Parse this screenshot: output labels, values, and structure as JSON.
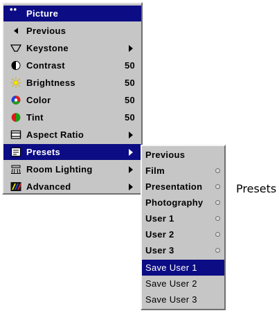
{
  "main_menu": {
    "title": "Picture",
    "items": [
      {
        "label": "Previous",
        "icon": "left-arrow-icon"
      },
      {
        "label": "Keystone",
        "icon": "keystone-icon",
        "submenu": true
      },
      {
        "label": "Contrast",
        "icon": "contrast-icon",
        "value": "50"
      },
      {
        "label": "Brightness",
        "icon": "brightness-icon",
        "value": "50"
      },
      {
        "label": "Color",
        "icon": "color-icon",
        "value": "50"
      },
      {
        "label": "Tint",
        "icon": "tint-icon",
        "value": "50"
      },
      {
        "label": "Aspect Ratio",
        "icon": "aspect-ratio-icon",
        "submenu": true
      },
      {
        "label": "Presets",
        "icon": "presets-icon",
        "submenu": true,
        "selected": true
      },
      {
        "label": "Room Lighting",
        "icon": "room-lighting-icon",
        "submenu": true
      },
      {
        "label": "Advanced",
        "icon": "advanced-icon",
        "submenu": true
      }
    ]
  },
  "presets_submenu": {
    "items": [
      {
        "label": "Previous"
      },
      {
        "label": "Film",
        "radio": true
      },
      {
        "label": "Presentation",
        "radio": true
      },
      {
        "label": "Photography",
        "radio": true
      },
      {
        "label": "User 1",
        "radio": true
      },
      {
        "label": "User 2",
        "radio": true
      },
      {
        "label": "User 3",
        "radio": true
      },
      {
        "label": "Save User 1",
        "selected": true
      },
      {
        "label": "Save User 2"
      },
      {
        "label": "Save User 3"
      }
    ]
  },
  "caption": "Presets",
  "colors": {
    "menu_bg": "#c6c6c6",
    "highlight": "#0c0c84",
    "highlight_text": "#ffffff"
  }
}
